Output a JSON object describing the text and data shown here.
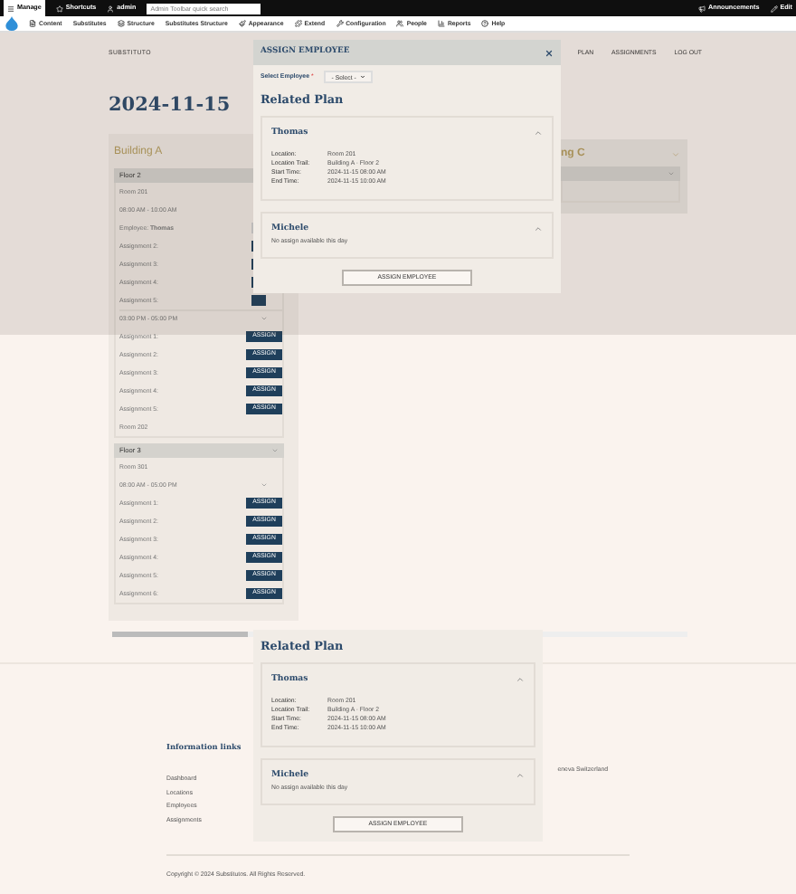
{
  "toolbar": {
    "manage": "Manage",
    "shortcuts": "Shortcuts",
    "user": "admin",
    "search_placeholder": "Admin Toolbar quick search",
    "announcements": "Announcements",
    "edit": "Edit"
  },
  "admin_menu": [
    "Content",
    "Substitutes",
    "Structure",
    "Substitutes Structure",
    "Appearance",
    "Extend",
    "Configuration",
    "People",
    "Reports",
    "Help"
  ],
  "site": {
    "brand": "SUBSTITUTO",
    "nav": [
      "PLAN",
      "ASSIGNMENTS",
      "LOG OUT"
    ]
  },
  "date": "2024-11-15",
  "building": {
    "name": "Building A",
    "floors": [
      {
        "name": "Floor 2",
        "rooms": [
          {
            "name": "Room 201",
            "slots": [
              {
                "time": "08:00 AM - 10:00 AM",
                "chevron": false,
                "employee": "Employee: **Thomas**",
                "assignments": [
                  {
                    "label": "Assignment 2:"
                  },
                  {
                    "label": "Assignment 3:"
                  },
                  {
                    "label": "Assignment 4:"
                  },
                  {
                    "label": "Assignment 5:"
                  }
                ]
              },
              {
                "time": "03:00 PM - 05:00 PM",
                "chevron": true,
                "assignments": [
                  {
                    "label": "Assignment 1:",
                    "action": "ASSIGN"
                  },
                  {
                    "label": "Assignment 2:",
                    "action": "ASSIGN"
                  },
                  {
                    "label": "Assignment 3:",
                    "action": "ASSIGN"
                  },
                  {
                    "label": "Assignment 4:",
                    "action": "ASSIGN"
                  },
                  {
                    "label": "Assignment 5:",
                    "action": "ASSIGN"
                  }
                ]
              }
            ]
          },
          {
            "name": "Room 202"
          }
        ]
      },
      {
        "name": "Floor 3",
        "rooms": [
          {
            "name": "Room 301",
            "slots": [
              {
                "time": "08:00 AM - 05:00 PM",
                "chevron": true,
                "assignments": [
                  {
                    "label": "Assignment 1:",
                    "action": "ASSIGN"
                  },
                  {
                    "label": "Assignment 2:",
                    "action": "ASSIGN"
                  },
                  {
                    "label": "Assignment 3:",
                    "action": "ASSIGN"
                  },
                  {
                    "label": "Assignment 4:",
                    "action": "ASSIGN"
                  },
                  {
                    "label": "Assignment 5:",
                    "action": "ASSIGN"
                  },
                  {
                    "label": "Assignment 6:",
                    "action": "ASSIGN"
                  }
                ]
              }
            ]
          }
        ]
      }
    ]
  },
  "building_c": {
    "name": "ng C"
  },
  "dialog": {
    "title": "ASSIGN EMPLOYEE",
    "select_label": "Select Employee",
    "required_mark": "*",
    "select_value": "- Select -",
    "plan": {
      "heading": "Related Plan",
      "cards": [
        {
          "name": "Thomas",
          "fields": [
            {
              "label": "Location:",
              "value": "Room 201"
            },
            {
              "label": "Location Trail:",
              "value": "Building A · Floor 2"
            },
            {
              "label": "Start Time:",
              "value": "2024-11-15 08:00 AM"
            },
            {
              "label": "End Time:",
              "value": "2024-11-15 10:00 AM"
            }
          ]
        },
        {
          "name": "Michele",
          "note": "No assign available this day"
        }
      ],
      "button": "ASSIGN EMPLOYEE"
    }
  },
  "related_panel": {
    "heading": "Related Plan",
    "cards": [
      {
        "name": "Thomas",
        "fields": [
          {
            "label": "Location:",
            "value": "Room 201"
          },
          {
            "label": "Location Trail:",
            "value": "Building A · Floor 2"
          },
          {
            "label": "Start Time:",
            "value": "2024-11-15 08:00 AM"
          },
          {
            "label": "End Time:",
            "value": "2024-11-15 10:00 AM"
          }
        ]
      },
      {
        "name": "Michele",
        "note": "No assign available this day"
      }
    ],
    "button": "ASSIGN EMPLOYEE"
  },
  "footer": {
    "heading": "Information links",
    "links": [
      "Dashboard",
      "Locations",
      "Employees",
      "Assignments"
    ],
    "address": "eneva Switzerland",
    "copyright": "Copyright © 2024 Substitutos. All Rights Reserved."
  }
}
